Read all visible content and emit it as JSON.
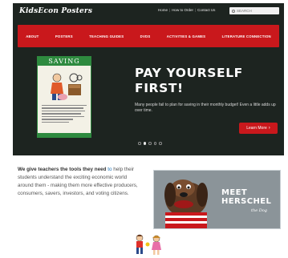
{
  "site": {
    "logo": "KidsEcon Posters"
  },
  "topnav": {
    "links": [
      "Home",
      "How to Order",
      "Contact Us"
    ],
    "search_placeholder": "SEARCH"
  },
  "mainnav": {
    "items": [
      "ABOUT",
      "POSTERS",
      "TEACHING GUIDES",
      "DVDS",
      "ACTIVITIES & GAMES",
      "LITERATURE CONNECTION"
    ]
  },
  "hero": {
    "poster_heading": "SAVING",
    "title_line1": "PAY YOURSELF",
    "title_line2": "FIRST!",
    "description": "Many people fail to plan for saving in their monthly budget! Even a little adds up over time.",
    "button_label": "Learn More",
    "slide_count": 5,
    "active_slide": 2
  },
  "intro": {
    "lead": "We give teachers the tools they need",
    "tail": " to",
    "body": "help their students understand the exciting economic world around them - making them more effective producers, consumers, savers, investors, and voting citizens."
  },
  "feature": {
    "title_line1": "MEET",
    "title_line2": "HERSCHEL",
    "subtitle": "the Dog"
  },
  "colors": {
    "brand_red": "#c9181c",
    "hero_bg": "#1d2420",
    "poster_green": "#2e8a3f",
    "link_blue": "#1f73b7"
  }
}
